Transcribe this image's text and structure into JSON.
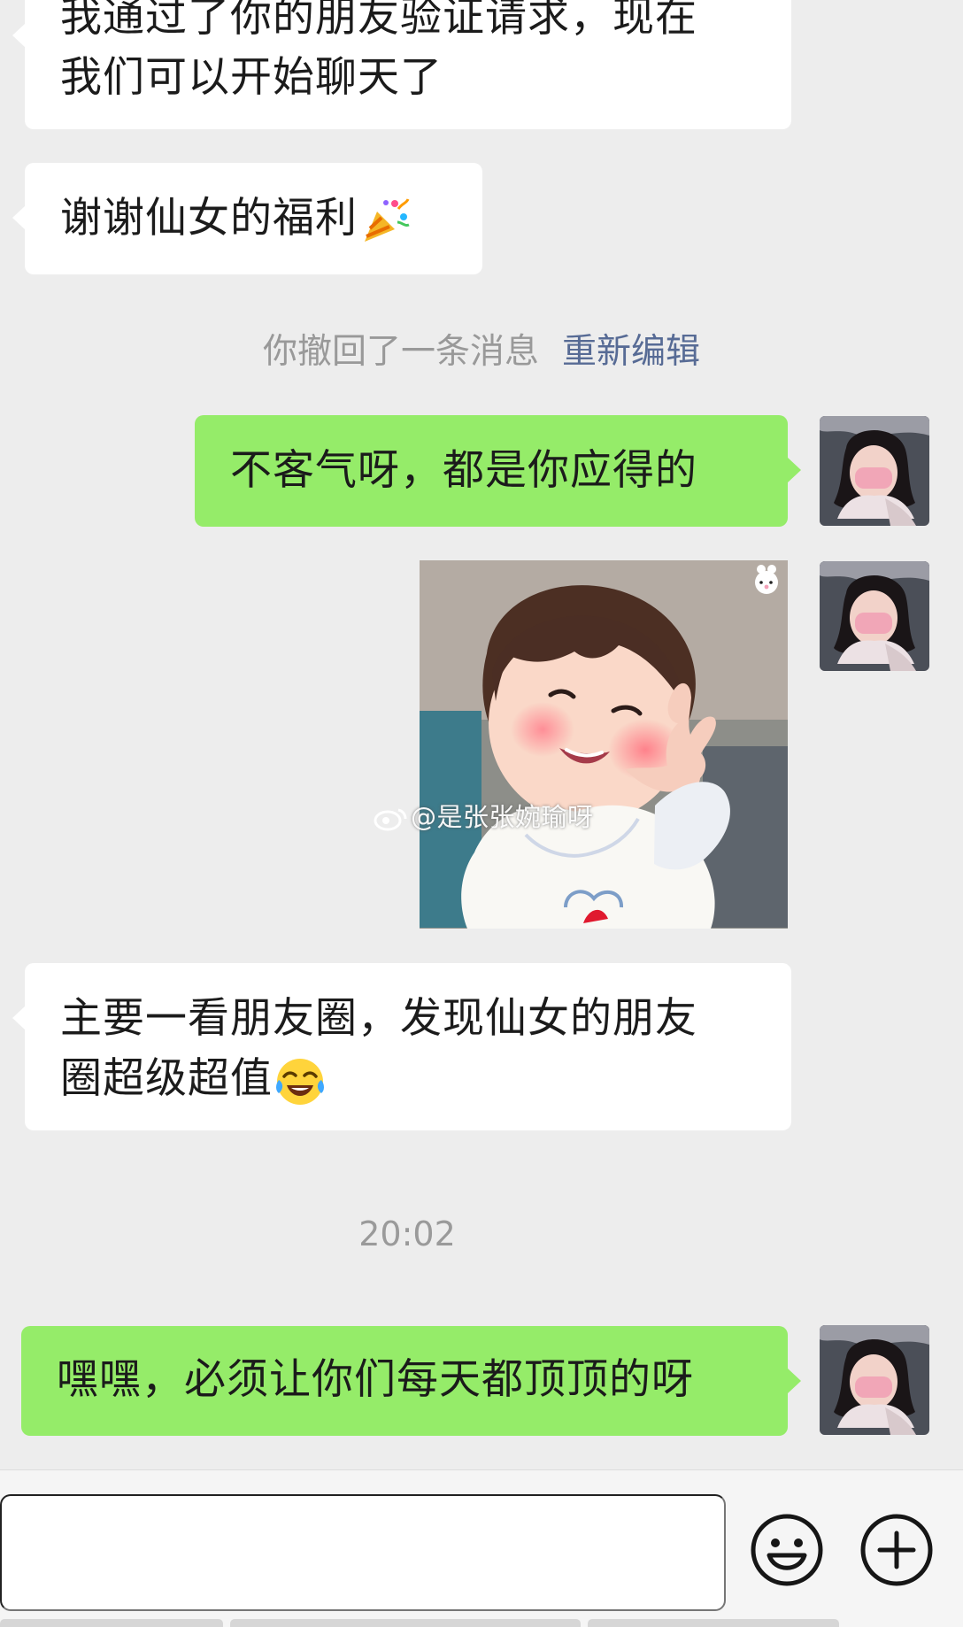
{
  "messages": {
    "m1": {
      "line1": "我通过了你的朋友验证请求，现在",
      "line2": "我们可以开始聊天了"
    },
    "m2": {
      "text": "谢谢仙女的福利",
      "emoji": "party-popper-icon"
    },
    "recall": {
      "text": "你撤回了一条消息",
      "link": "重新编辑"
    },
    "m3": {
      "text": "不客气呀，都是你应得的"
    },
    "sticker": {
      "watermark": "@是张张婉瑜呀",
      "icon": "bunny-icon"
    },
    "m4": {
      "line1": "主要一看朋友圈，发现仙女的朋友",
      "line2": "圈超级超值",
      "emoji": "tears-of-joy-icon"
    },
    "timestamp": "20:02",
    "m5": {
      "text": "嘿嘿，必须让你们每天都顶顶的呀"
    }
  },
  "input": {
    "placeholder": "",
    "emoji_button": "emoji-icon",
    "plus_button": "plus-icon"
  },
  "colors": {
    "background": "#ededed",
    "incoming_bubble": "#ffffff",
    "outgoing_bubble": "#95ec69",
    "link": "#576b95",
    "system_text": "#999999"
  }
}
